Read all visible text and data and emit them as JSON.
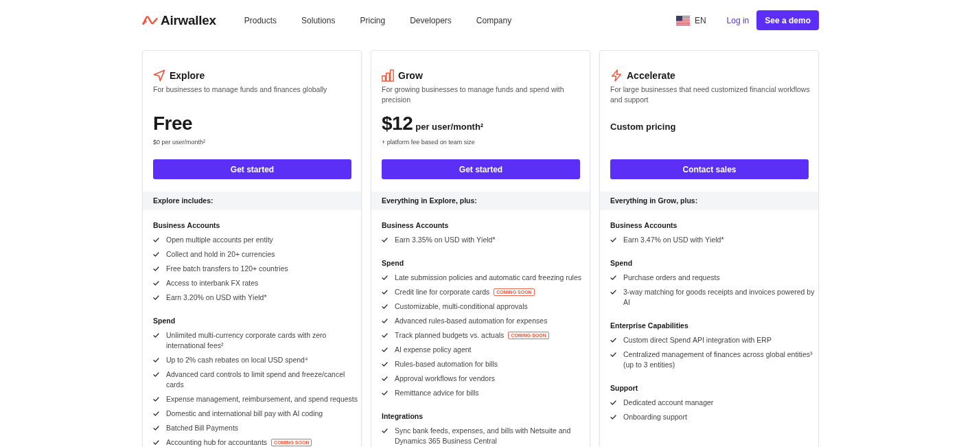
{
  "header": {
    "logo": "Airwallex",
    "nav": [
      "Products",
      "Solutions",
      "Pricing",
      "Developers",
      "Company"
    ],
    "language": "EN",
    "login": "Log in",
    "cta": "See a demo"
  },
  "plans": [
    {
      "title": "Explore",
      "description": "For businesses to manage funds and finances globally",
      "price": {
        "amount": "Free",
        "note": "$0 per user/month²"
      },
      "button": "Get started",
      "includes": "Explore includes:",
      "groups": [
        {
          "heading": "Business Accounts",
          "items": [
            {
              "text": "Open multiple accounts per entity"
            },
            {
              "text": "Collect and hold in 20+ currencies"
            },
            {
              "text": "Free batch transfers to 120+ countries"
            },
            {
              "text": "Access to interbank FX rates"
            },
            {
              "text": "Earn 3.20% on USD with Yield*"
            }
          ]
        },
        {
          "heading": "Spend",
          "items": [
            {
              "text": "Unlimited multi-currency corporate cards with zero international fees²"
            },
            {
              "text": "Up to 2% cash rebates on local USD spend⁴"
            },
            {
              "text": "Advanced card controls to limit spend and freeze/cancel cards"
            },
            {
              "text": "Expense management, reimbursement, and spend requests"
            },
            {
              "text": "Domestic and international bill pay with AI coding"
            },
            {
              "text": "Batched Bill Payments"
            },
            {
              "text": "Accounting hub for accountants",
              "badge": "COMING SOON"
            }
          ]
        }
      ]
    },
    {
      "title": "Grow",
      "description": "For growing businesses to manage funds and spend with precision",
      "price": {
        "amount": "$12",
        "unit": "per user/month²",
        "note": "+ platform fee based on team size"
      },
      "button": "Get started",
      "includes": "Everything in Explore, plus:",
      "groups": [
        {
          "heading": "Business Accounts",
          "items": [
            {
              "text": "Earn 3.35% on USD with Yield*"
            }
          ]
        },
        {
          "heading": "Spend",
          "items": [
            {
              "text": "Late submission policies and automatic card freezing rules"
            },
            {
              "text": "Credit line for corporate cards",
              "badge": "COMING SOON"
            },
            {
              "text": "Customizable, multi-conditional approvals"
            },
            {
              "text": "Advanced rules-based automation for expenses"
            },
            {
              "text": "Track planned budgets vs. actuals",
              "badge": "COMING SOON"
            },
            {
              "text": "AI expense policy agent"
            },
            {
              "text": "Rules-based automation for bills"
            },
            {
              "text": "Approval workflows for vendors"
            },
            {
              "text": "Remittance advice for bills"
            }
          ]
        },
        {
          "heading": "Integrations",
          "items": [
            {
              "text": "Sync bank feeds, expenses, and bills with Netsuite and Dynamics 365 Business Central"
            }
          ]
        }
      ]
    },
    {
      "title": "Accelerate",
      "description": "For large businesses that need customized financial workflows and support",
      "price": {
        "label": "Custom pricing"
      },
      "button": "Contact sales",
      "includes": "Everything in Grow, plus:",
      "groups": [
        {
          "heading": "Business Accounts",
          "items": [
            {
              "text": "Earn 3.47% on USD with Yield*"
            }
          ]
        },
        {
          "heading": "Spend",
          "items": [
            {
              "text": "Purchase orders and requests"
            },
            {
              "text": "3-way matching for goods receipts and invoices powered by AI"
            }
          ]
        },
        {
          "heading": "Enterprise Capabilities",
          "items": [
            {
              "text": "Custom direct Spend API integration with ERP"
            },
            {
              "text": "Centralized management of finances across global entities³ (up to 3 entities)"
            }
          ]
        },
        {
          "heading": "Support",
          "items": [
            {
              "text": "Dedicated account manager"
            },
            {
              "text": "Onboarding support"
            }
          ]
        }
      ]
    }
  ]
}
